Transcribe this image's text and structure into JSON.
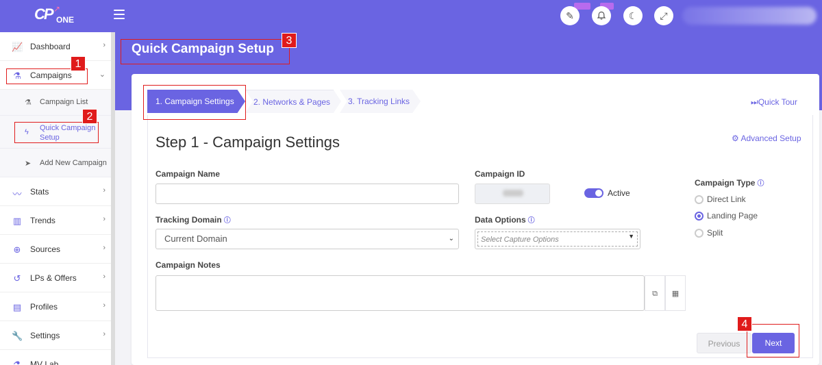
{
  "topbar": {
    "logo": {
      "brand": "CP",
      "suffix": "ONE"
    },
    "icons": [
      "magic-wand-icon",
      "bell-icon",
      "moon-icon",
      "expand-icon"
    ]
  },
  "sidebar": {
    "items": [
      {
        "label": "Dashboard",
        "icon": "chart-line-icon"
      },
      {
        "label": "Campaigns",
        "icon": "flask-icon"
      },
      {
        "label": "Stats",
        "icon": "stats-icon"
      },
      {
        "label": "Trends",
        "icon": "trends-icon"
      },
      {
        "label": "Sources",
        "icon": "globe-icon"
      },
      {
        "label": "LPs & Offers",
        "icon": "history-icon"
      },
      {
        "label": "Profiles",
        "icon": "clipboard-icon"
      },
      {
        "label": "Settings",
        "icon": "wrench-icon"
      },
      {
        "label": "MV Lab",
        "icon": "lab-icon"
      }
    ],
    "campaign_sub": [
      {
        "label": "Campaign List"
      },
      {
        "label": "Quick Campaign Setup"
      },
      {
        "label": "Add New Campaign"
      }
    ]
  },
  "page": {
    "title": "Quick Campaign Setup"
  },
  "wizard": {
    "steps": [
      "1. Campaign Settings",
      "2. Networks & Pages",
      "3. Tracking Links"
    ],
    "quick_tour": "Quick Tour",
    "step_title": "Step 1 - Campaign Settings",
    "advanced_setup": "Advanced Setup"
  },
  "form": {
    "campaign_name_label": "Campaign Name",
    "campaign_name_value": "",
    "campaign_id_label": "Campaign ID",
    "active_label": "Active",
    "active_on": true,
    "tracking_domain_label": "Tracking Domain",
    "tracking_domain_value": "Current Domain",
    "data_options_label": "Data Options",
    "data_options_placeholder": "Select Capture Options",
    "campaign_type_label": "Campaign Type",
    "campaign_types": [
      "Direct Link",
      "Landing Page",
      "Split"
    ],
    "campaign_type_selected": "Landing Page",
    "campaign_notes_label": "Campaign Notes",
    "campaign_notes_value": ""
  },
  "buttons": {
    "previous": "Previous",
    "next": "Next"
  },
  "annotations": [
    "1",
    "2",
    "3",
    "4"
  ],
  "colors": {
    "accent": "#6a64e2",
    "annotation": "#e01b1b"
  }
}
